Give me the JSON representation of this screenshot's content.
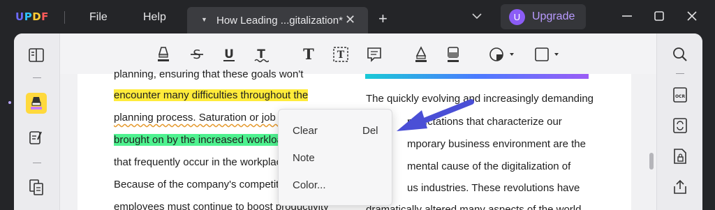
{
  "app": {
    "logo": [
      "U",
      "P",
      "D",
      "F"
    ],
    "menu": [
      "File",
      "Help"
    ],
    "tab_title": "How Leading ...gitalization*",
    "upgrade_badge": "U",
    "upgrade_label": "Upgrade"
  },
  "document": {
    "left_lines": [
      "planning, ensuring that these goals won't",
      "encounter many difficulties throughout the",
      "planning process. Saturation or job ti",
      "brought on by the increased workloa",
      "that frequently occur in the workplac",
      "Because of the company's competito",
      "employees must continue to boost productivity"
    ],
    "right_lines": [
      "The quickly evolving and increasingly demanding",
      "mpectations that characterize our",
      "mporary business environment are the",
      "mental cause of the digitalization of",
      "us industries. These revolutions have",
      "dramatically altered many aspects of the world"
    ]
  },
  "context_menu": {
    "items": [
      {
        "label": "Clear",
        "shortcut": "Del"
      },
      {
        "label": "Note",
        "shortcut": ""
      },
      {
        "label": "Color...",
        "shortcut": ""
      }
    ]
  },
  "colors": {
    "highlight_yellow": "#ffeb3b",
    "highlight_green": "#4ef28f",
    "accent_purple": "#8b5cf6",
    "arrow_blue": "#4a4fd6"
  },
  "icons": {
    "toolbar": [
      "highlighter-icon",
      "strikethrough-icon",
      "underline-icon",
      "squiggly-underline-icon",
      "text-icon",
      "textbox-icon",
      "note-icon",
      "pencil-icon",
      "eraser-icon",
      "shape-icon",
      "rectangle-icon"
    ],
    "left": [
      "reader-icon",
      "comment-icon",
      "edit-icon",
      "organize-icon"
    ],
    "right": [
      "search-icon",
      "ocr-icon",
      "convert-icon",
      "protect-icon",
      "share-icon"
    ]
  }
}
